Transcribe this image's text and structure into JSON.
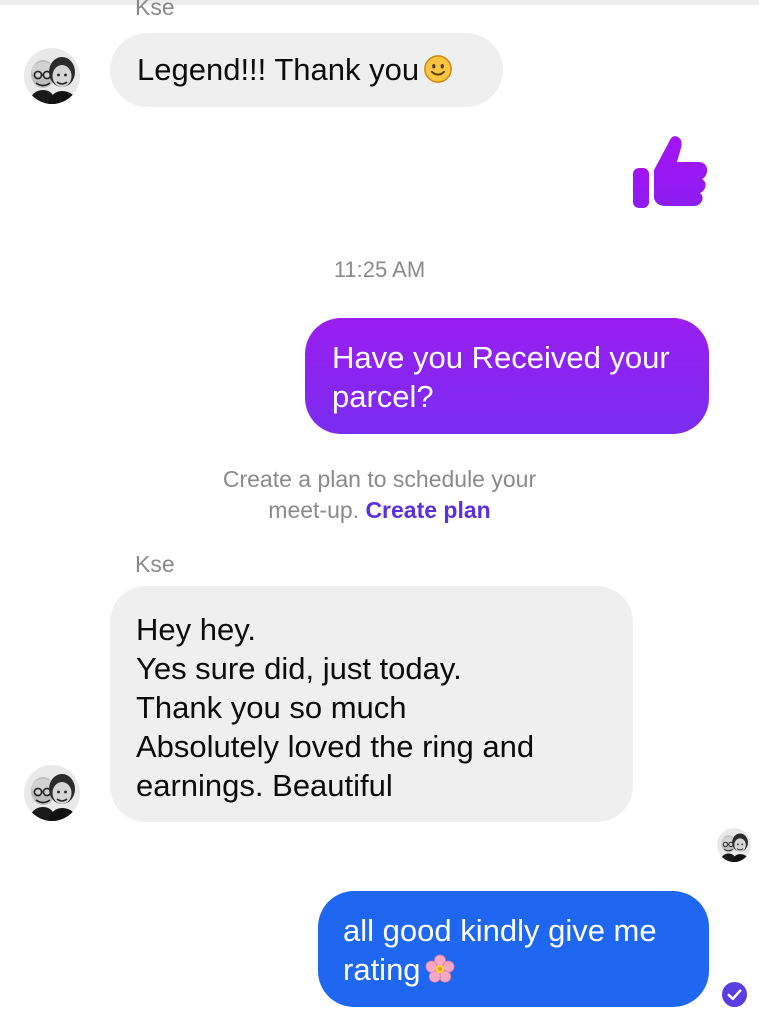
{
  "conversation": {
    "top_sender_name": "Kse",
    "messages": [
      {
        "direction": "incoming",
        "lines": [
          "Legend!!! Thank you"
        ],
        "emoji": "slightly-smiling-face"
      },
      {
        "direction": "outgoing",
        "type": "like",
        "icon": "thumbs-up-icon"
      },
      {
        "direction": "outgoing",
        "lines": [
          "Have you Received your",
          "parcel?"
        ]
      },
      {
        "direction": "incoming",
        "sender": "Kse",
        "lines": [
          "Hey hey.",
          "Yes sure did, just today.",
          "Thank you so much",
          "Absolutely loved the ring and",
          "earnings. Beautiful"
        ]
      },
      {
        "direction": "outgoing",
        "lines": [
          "all good kindly give me",
          "rating"
        ],
        "emoji": "cherry-blossom"
      }
    ],
    "timestamp": "11:25 AM",
    "plan_prompt": {
      "line1": "Create a plan to schedule your",
      "line2": "meet-up.",
      "link": "Create plan"
    }
  },
  "colors": {
    "incoming_bubble": "#efefef",
    "outgoing_purple": "#8a24f0",
    "outgoing_blue": "#1f67f0",
    "link": "#5a2fe0",
    "meta_text": "#8a8a8a"
  }
}
